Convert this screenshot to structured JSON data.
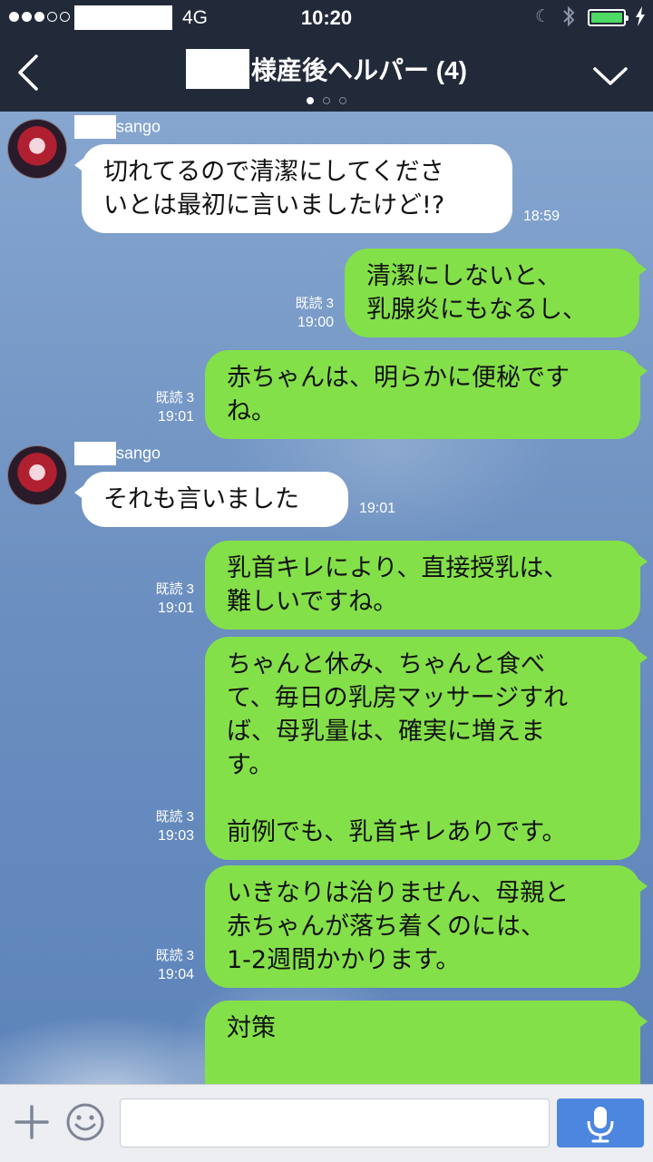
{
  "status_bar": {
    "signal_dots_filled": 3,
    "signal_dots_total": 5,
    "network": "4G",
    "time": "10:20",
    "moon_icon": "moon-icon",
    "bluetooth_icon": "bluetooth-icon",
    "battery_level": 1.0,
    "charging_icon": "bolt-icon"
  },
  "nav": {
    "title": "様産後ヘルパー (4)",
    "back_icon": "chevron-left-icon",
    "menu_icon": "chevron-down-icon",
    "page_indicator_current": 1,
    "page_indicator_total": 3
  },
  "messages": [
    {
      "direction": "in",
      "sender": "sango",
      "text": "切れてるので清潔にしてくださ\nいとは最初に言いましたけど!?",
      "time": "18:59"
    },
    {
      "direction": "out",
      "read": "既読 3",
      "time": "19:00",
      "text": "清潔にしないと、\n乳腺炎にもなるし、"
    },
    {
      "direction": "out",
      "read": "既読 3",
      "time": "19:01",
      "text": "赤ちゃんは、明らかに便秘です\nね。"
    },
    {
      "direction": "in",
      "sender": "sango",
      "text": "それも言いました",
      "time": "19:01"
    },
    {
      "direction": "out",
      "read": "既読 3",
      "time": "19:01",
      "text": "乳首キレにより、直接授乳は、\n難しいですね。"
    },
    {
      "direction": "out",
      "read": "既読 3",
      "time": "19:03",
      "text": "ちゃんと休み、ちゃんと食べ\nて、毎日の乳房マッサージすれ\nば、母乳量は、確実に増えま\nす。\n\n前例でも、乳首キレありです。"
    },
    {
      "direction": "out",
      "read": "既読 3",
      "time": "19:04",
      "text": "いきなりは治りません、母親と\n赤ちゃんが落ち着くのには、\n1-2週間かかります。"
    },
    {
      "direction": "out",
      "text": "対策"
    }
  ],
  "input_bar": {
    "plus_icon": "plus-icon",
    "emoji_icon": "smiley-icon",
    "placeholder": "",
    "mic_icon": "microphone-icon"
  },
  "colors": {
    "nav_bg": "#222a3a",
    "outgoing_bubble": "#84e049",
    "incoming_bubble": "#ffffff",
    "mic_button": "#4c86de",
    "battery_fill": "#4cd964"
  }
}
